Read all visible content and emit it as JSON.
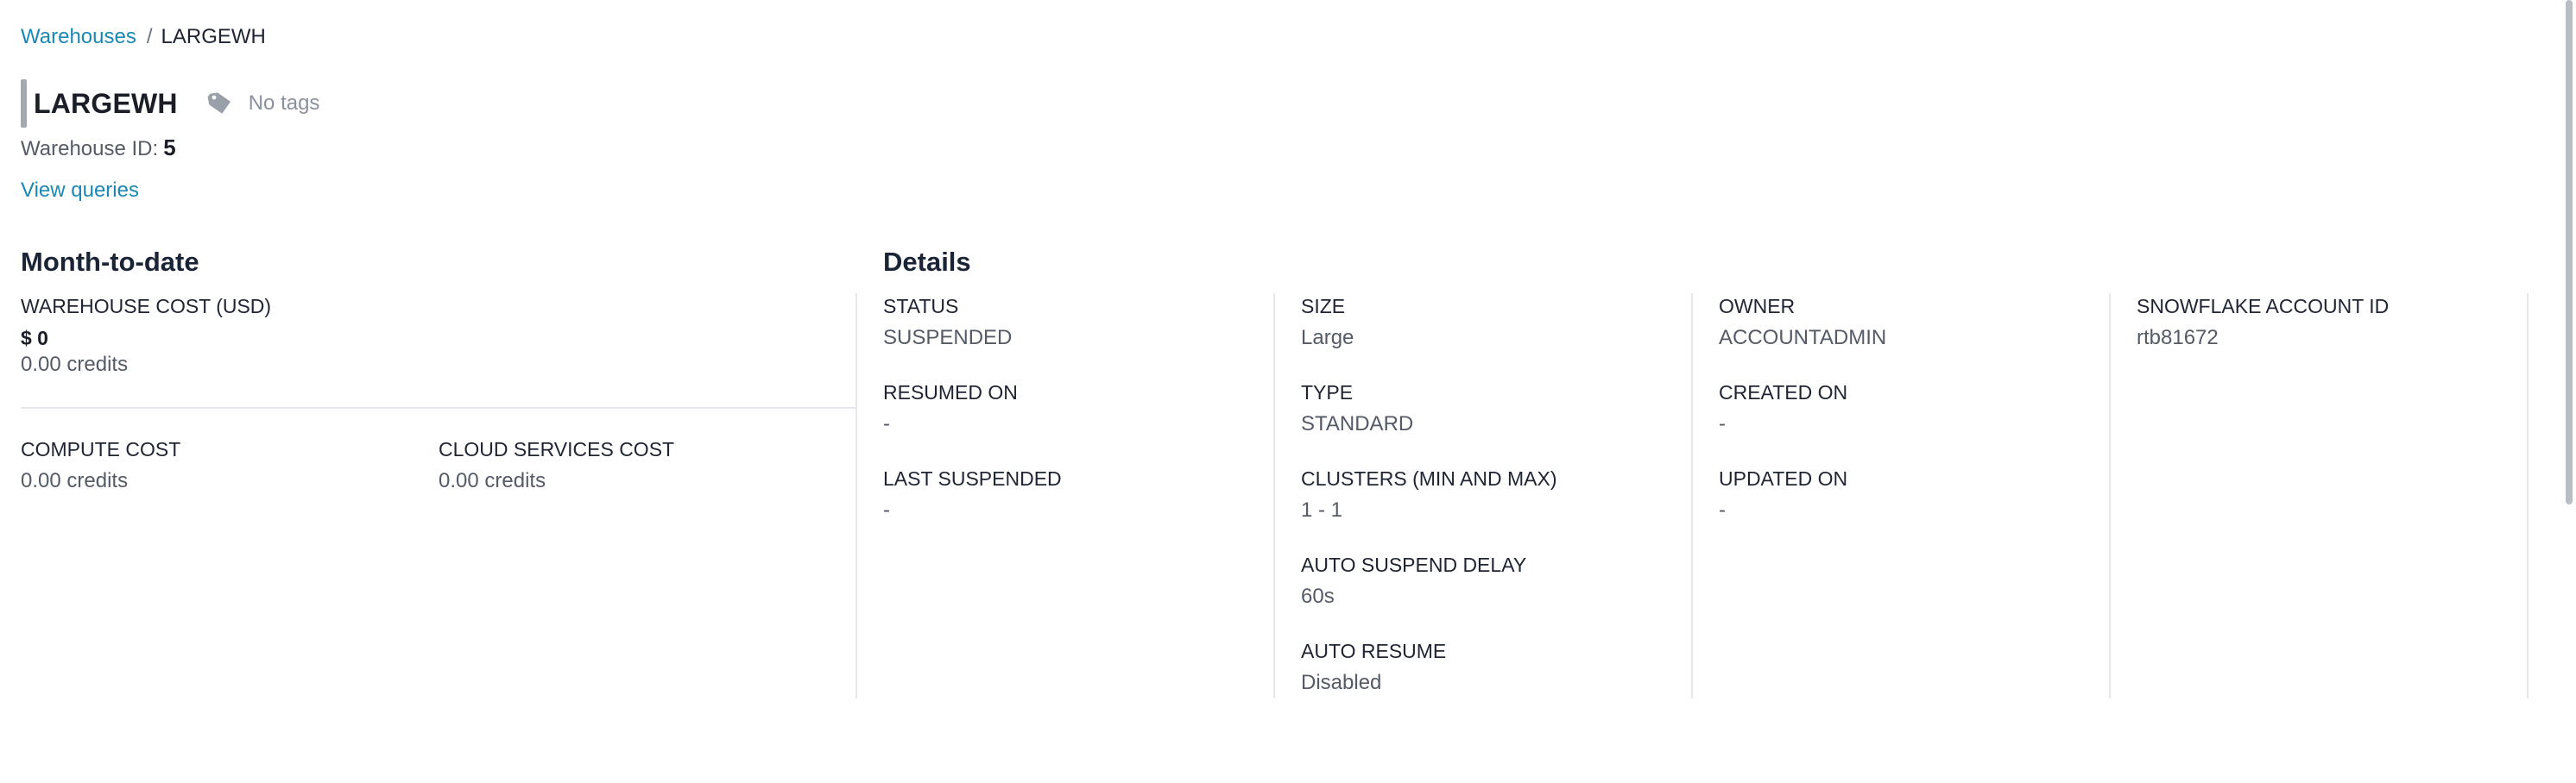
{
  "breadcrumb": {
    "parent": "Warehouses",
    "separator": "/",
    "current": "LARGEWH"
  },
  "header": {
    "title": "LARGEWH",
    "tag_icon": "tag-icon",
    "no_tags": "No tags",
    "warehouse_id_label": "Warehouse ID:",
    "warehouse_id_value": "5",
    "view_queries": "View queries"
  },
  "month_to_date": {
    "title": "Month-to-date",
    "warehouse_cost_label": "WAREHOUSE COST (USD)",
    "warehouse_cost_value": "$ 0",
    "warehouse_cost_credits": "0.00 credits",
    "compute_cost_label": "COMPUTE COST",
    "compute_cost_value": "0.00 credits",
    "cloud_services_cost_label": "CLOUD SERVICES COST",
    "cloud_services_cost_value": "0.00 credits"
  },
  "details": {
    "title": "Details",
    "columns": [
      [
        {
          "label": "STATUS",
          "value": "SUSPENDED"
        },
        {
          "label": "RESUMED ON",
          "value": "-"
        },
        {
          "label": "LAST SUSPENDED",
          "value": "-"
        }
      ],
      [
        {
          "label": "SIZE",
          "value": "Large"
        },
        {
          "label": "TYPE",
          "value": "STANDARD"
        },
        {
          "label": "CLUSTERS (MIN AND MAX)",
          "value": "1 - 1"
        },
        {
          "label": "AUTO SUSPEND DELAY",
          "value": "60s"
        },
        {
          "label": "AUTO RESUME",
          "value": "Disabled"
        }
      ],
      [
        {
          "label": "OWNER",
          "value": "ACCOUNTADMIN"
        },
        {
          "label": "CREATED ON",
          "value": "-"
        },
        {
          "label": "UPDATED ON",
          "value": "-"
        }
      ],
      [
        {
          "label": "SNOWFLAKE ACCOUNT ID",
          "value": "rtb81672"
        }
      ]
    ]
  },
  "colors": {
    "link": "#1a88b4",
    "accent_bar": "#a3a8b1",
    "divider": "#e5e7eb"
  }
}
